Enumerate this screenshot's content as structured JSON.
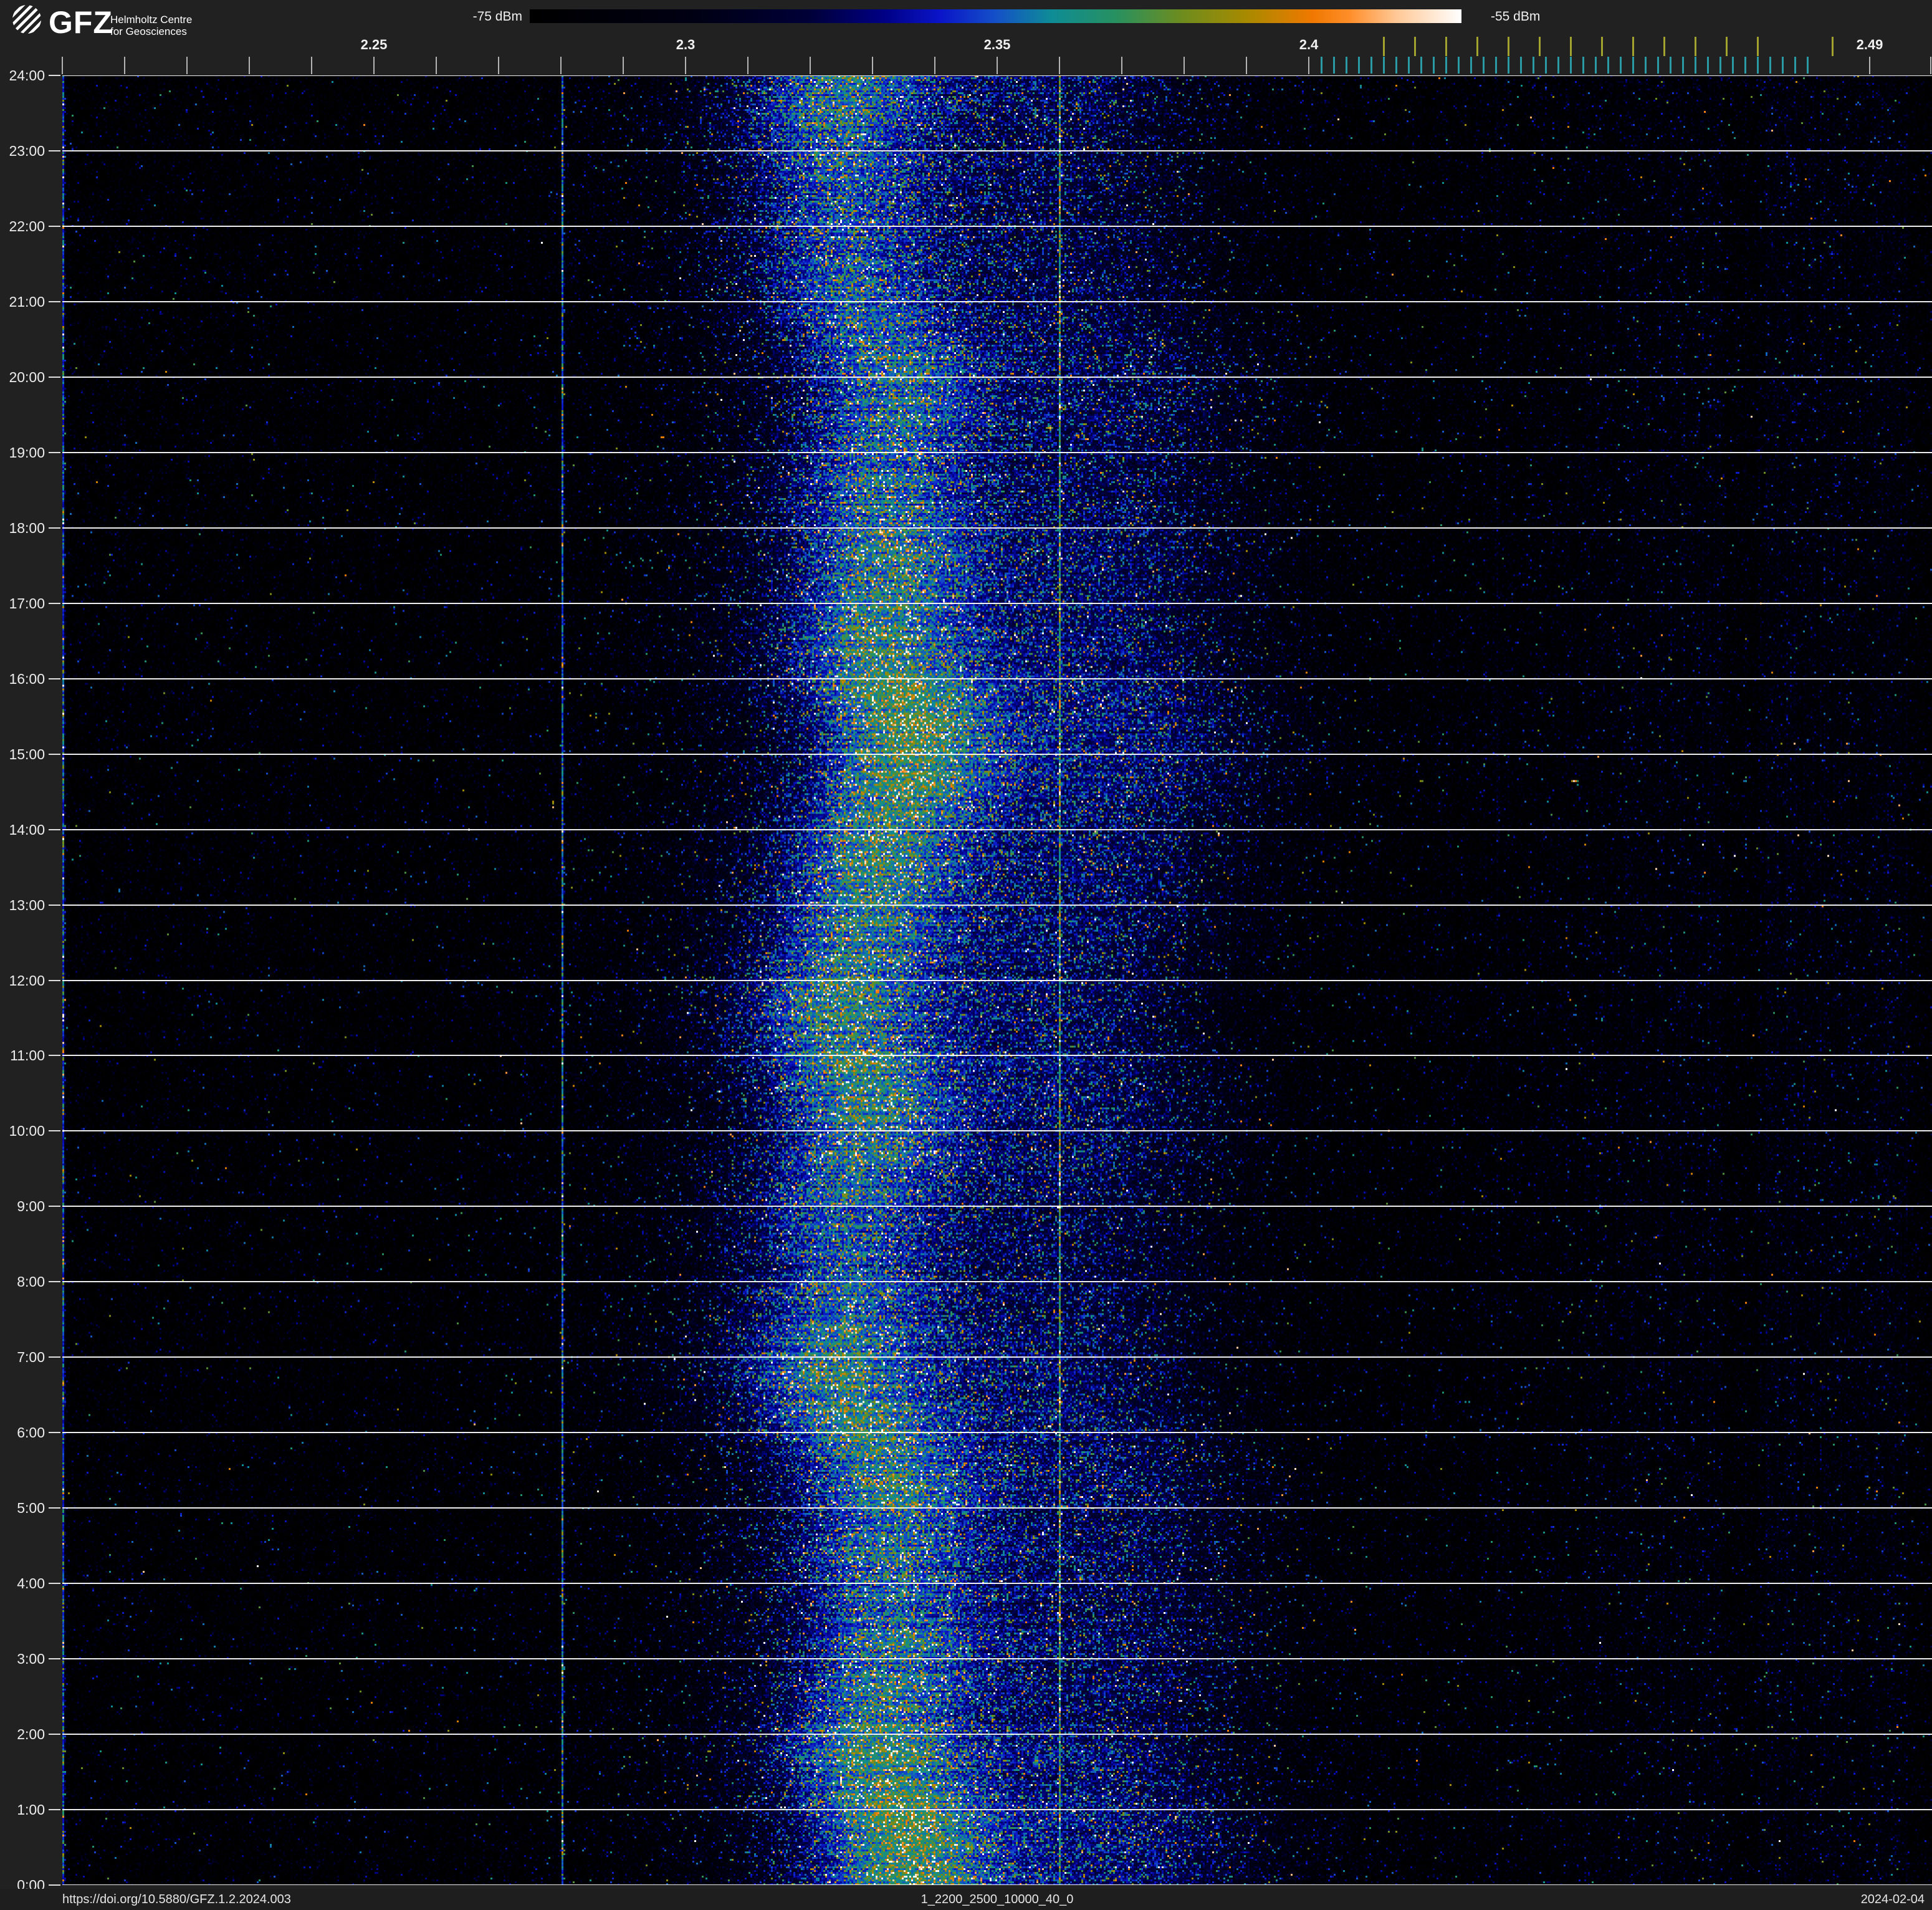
{
  "header": {
    "brand": "GFZ",
    "org_line1": "Helmholtz Centre",
    "org_line2": "for Geosciences"
  },
  "colorbar": {
    "min_label": "-75 dBm",
    "max_label": "-55 dBm"
  },
  "footer": {
    "doi": "https://doi.org/10.5880/GFZ.1.2.2024.003",
    "dataset_id": "1_2200_2500_10000_40_0",
    "date": "2024-02-04"
  },
  "chart_data": {
    "type": "heatmap",
    "subtype": "radio-spectrogram-waterfall-24h",
    "x_axis": {
      "unit": "GHz",
      "min": 2.2,
      "max": 2.5,
      "labeled_ticks": [
        {
          "value": 2.25,
          "label": "2.25"
        },
        {
          "value": 2.3,
          "label": "2.3"
        },
        {
          "value": 2.35,
          "label": "2.35"
        },
        {
          "value": 2.4,
          "label": "2.4"
        },
        {
          "value": 2.49,
          "label": "2.49"
        }
      ],
      "minor_tick_step": 0.01,
      "minor_tick_range": [
        2.2,
        2.4
      ],
      "extra_minor_ticks": [
        2.49,
        2.5
      ],
      "wlan_channel_ticks_mhz": {
        "start": 2412,
        "stop": 2472,
        "step": 5,
        "extra": [
          2484
        ]
      },
      "ble_channel_ticks_mhz": {
        "start": 2402,
        "stop": 2480,
        "step": 2
      }
    },
    "y_axis": {
      "unit": "hour of day",
      "min": 0,
      "max": 24,
      "tick_step": 1,
      "labels": [
        "24:00",
        "23:00",
        "22:00",
        "21:00",
        "20:00",
        "19:00",
        "18:00",
        "17:00",
        "16:00",
        "15:00",
        "14:00",
        "13:00",
        "12:00",
        "11:00",
        "10:00",
        "9:00",
        "8:00",
        "7:00",
        "6:00",
        "5:00",
        "4:00",
        "3:00",
        "2:00",
        "1:00",
        "0:00"
      ]
    },
    "power_scale_dbm": {
      "min": -75,
      "max": -55
    },
    "colormap_stops": [
      {
        "pos": 0.0,
        "color": "#000000"
      },
      {
        "pos": 0.18,
        "color": "#000014"
      },
      {
        "pos": 0.3,
        "color": "#000038"
      },
      {
        "pos": 0.38,
        "color": "#000084"
      },
      {
        "pos": 0.44,
        "color": "#0a14c8"
      },
      {
        "pos": 0.5,
        "color": "#1450c8"
      },
      {
        "pos": 0.56,
        "color": "#0e8c96"
      },
      {
        "pos": 0.63,
        "color": "#28915f"
      },
      {
        "pos": 0.7,
        "color": "#6e8c1e"
      },
      {
        "pos": 0.77,
        "color": "#a88a00"
      },
      {
        "pos": 0.84,
        "color": "#f07800"
      },
      {
        "pos": 0.88,
        "color": "#ff8e2a"
      },
      {
        "pos": 0.93,
        "color": "#ffc896"
      },
      {
        "pos": 1.0,
        "color": "#ffffff"
      }
    ],
    "features": {
      "noise_floor_dbm": -74.7,
      "broadband_emission": {
        "center_ghz": 2.3285,
        "center_wobble_ghz": 0.005,
        "core_peak_db": 6.5,
        "core_sigma_ghz": 0.016,
        "pedestal_peak_db": 5.5,
        "pedestal_sigma_ghz": 0.04,
        "pedestal_offset_ghz": 0.01,
        "shoulder_peak_db": 3.5,
        "shoulder_sigma_ghz": 0.022,
        "shoulder_offset_ghz": 0.042,
        "visible_extent_ghz": [
          2.295,
          2.385
        ],
        "peak_power_dbm": -63
      },
      "carriers": [
        {
          "freq_ghz": 2.2,
          "level_db": 10.5,
          "color_hint": "teal-edge"
        },
        {
          "freq_ghz": 2.28,
          "level_db": 11.2,
          "color_hint": "teal"
        },
        {
          "freq_ghz": 2.36,
          "level_db": 13.5,
          "color_hint": "olive"
        }
      ],
      "grid_columns": {
        "step_ghz": 0.01,
        "level_db": 1.0,
        "strong": [
          {
            "freq_ghz": 2.4,
            "level_db": 2.2
          },
          {
            "freq_ghz": 2.43,
            "level_db": 2.2
          }
        ]
      },
      "ism_noise": {
        "range_ghz": [
          2.403,
          2.496
        ],
        "ramp_full_ghz": 2.45,
        "streak_db": 1.5,
        "base_db": 0.45,
        "dark_lane_ghz": [
          2.4665,
          2.472
        ],
        "bright_zone_ghz": [
          2.473,
          2.495
        ]
      },
      "transients": [
        {
          "freq_ghz": 2.4179,
          "hour": 14.65,
          "levels_db": [
            17.5,
            16.5
          ],
          "color_hint": "orange"
        },
        {
          "freq_ghz": 2.4422,
          "hour": 14.65,
          "levels_db": [
            15.5,
            18,
            17.5,
            15
          ],
          "color_hint": "orange"
        },
        {
          "freq_ghz": 2.4697,
          "hour": 14.65,
          "levels_db": [
            12.5,
            13.5
          ],
          "color_hint": "green"
        },
        {
          "freq_ghz": 2.4579,
          "hour": 13.44,
          "levels_db": [
            10.5,
            11
          ],
          "color_hint": "cyan"
        },
        {
          "freq_ghz": 2.253,
          "hour": 14.69,
          "levels_db": [
            6.5
          ],
          "color_hint": "blue"
        }
      ]
    },
    "render_hints": {
      "seed": 20240204,
      "cols": 1000,
      "rows": 968
    }
  }
}
